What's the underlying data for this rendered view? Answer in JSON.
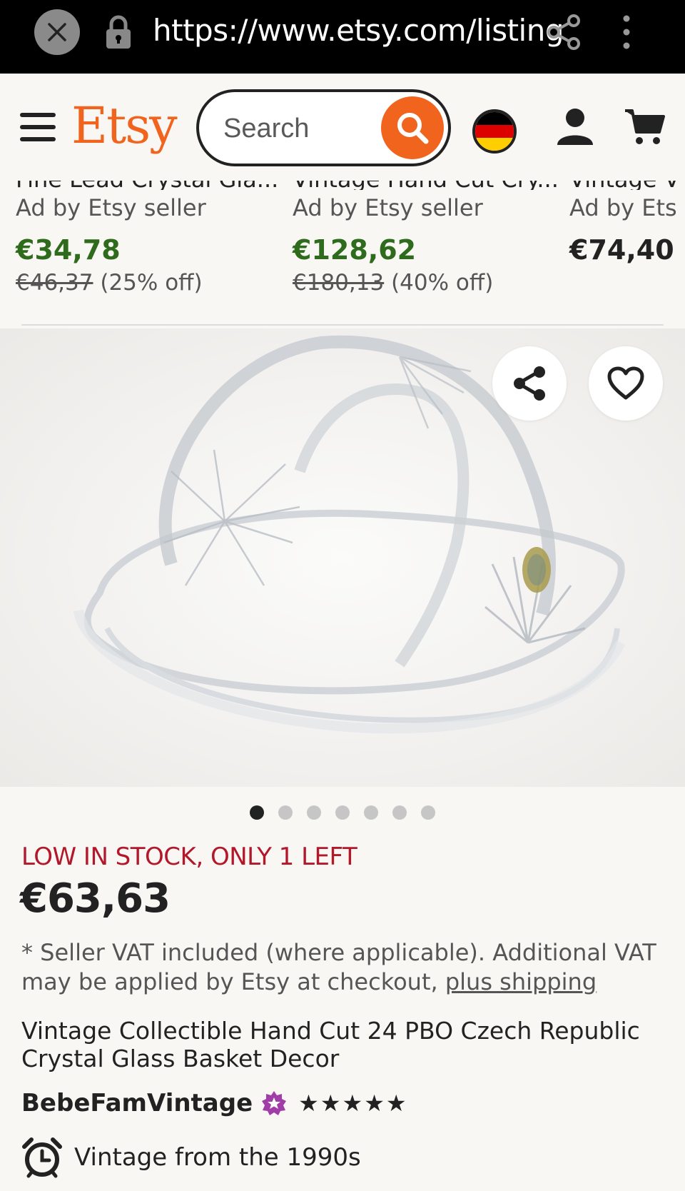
{
  "browser": {
    "url": "https://www.etsy.com/listing"
  },
  "header": {
    "logo": "Etsy",
    "search_placeholder": "Search",
    "brand_color": "#f1641e"
  },
  "ads": [
    {
      "title": "Fine Lead Crystal Gla...",
      "seller": "Ad by Etsy seller",
      "price": "€34,78",
      "original_price": "€46,37",
      "discount": "(25% off)"
    },
    {
      "title": "Vintage Hand Cut Cry...",
      "seller": "Ad by Etsy seller",
      "price": "€128,62",
      "original_price": "€180,13",
      "discount": "(40% off)"
    },
    {
      "title": "Vintage V",
      "seller": "Ad by Ets",
      "price": "€74,40"
    }
  ],
  "carousel": {
    "total": 7,
    "active_index": 0
  },
  "product": {
    "stock_notice": "LOW IN STOCK, ONLY 1 LEFT",
    "price": "€63,63",
    "vat_note": "* Seller VAT included (where applicable). Additional VAT may be applied by Etsy at checkout,",
    "shipping_link": "plus shipping",
    "title": "Vintage Collectible Hand Cut 24 PBO Czech Republic Crystal Glass Basket Decor",
    "shop_name": "BebeFamVintage",
    "rating_stars": "★★★★★",
    "vintage_info": "Vintage from the 1990s"
  },
  "colors": {
    "sale_price": "#2f6b1c",
    "stock_warning": "#b3172a",
    "star_seller": "#a03da6"
  },
  "icons": [
    "close-icon",
    "lock-icon",
    "share-icon",
    "more-vertical-icon",
    "hamburger-icon",
    "search-icon",
    "germany-flag-icon",
    "user-icon",
    "cart-icon",
    "heart-icon",
    "star-seller-badge-icon",
    "alarm-clock-icon"
  ]
}
